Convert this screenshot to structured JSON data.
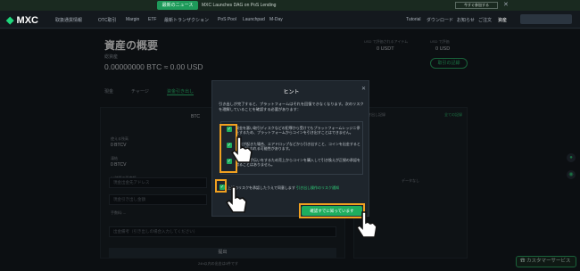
{
  "banner": {
    "pill": "最新のニュース",
    "message": "MXC Launches DAG on PoS Lending",
    "join": "今すぐ参加する",
    "close": "✕"
  },
  "nav": {
    "logo_text": "MXC",
    "items": [
      "取扱通貨情報",
      "OTC取引",
      "Margin",
      "ETF",
      "最新トランザクション",
      "PoS Pool",
      "Launchpad",
      "M-Day"
    ],
    "right_items": [
      "Tutorial",
      "ダウンロード",
      "お知らせ",
      "ご注文",
      "資産"
    ]
  },
  "page": {
    "title": "資産の概要",
    "subtitle": "総資産",
    "balance": "0.00000000 BTC ≈ 0.00 USD",
    "stats": [
      {
        "label": "USD で評価されるアイテム",
        "value": "0 USDT"
      },
      {
        "label": "USD で評価",
        "value": "0 USD"
      }
    ],
    "history_btn": "取引の記録",
    "tabs": [
      "現金",
      "チャージ",
      "資金引き出し"
    ]
  },
  "left_panel": {
    "coin": "BTC",
    "rows": [
      {
        "label": "使える残高",
        "value": "0 BTCV"
      },
      {
        "label": "凍結",
        "value": "0 BTCV"
      },
      {
        "label": "24時間の限度額",
        "value": "0 BTCV"
      }
    ],
    "address_placeholder": "現金出金先アドレス",
    "amount_placeholder": "現金引き出し金額",
    "fee_label": "手数料: --",
    "memo_placeholder": "出金備考（引き出しの場合入力してください）",
    "submit": "提出",
    "note": "24h以内の出金は0件です"
  },
  "right_panel": {
    "title": "現金引き出し記録",
    "link": "全ての記録",
    "empty": "データなし"
  },
  "support": "カスタマーサービス",
  "modal": {
    "title": "ヒント",
    "close": "✕",
    "intro": "引き出しが完了すると、プラットフォームはそれを回復できなくなります。次のリスクを理解していることを確認する必要があります：",
    "items": [
      "資金を悪い取引ディスクなどの犯罪から受けてもプラットフォームレッジニ停止するため、プラットフォームからコインを引き出すことはできません。",
      "詐欺が起きた場合、エアドロップなどから引き出すこと、コインを出金すると資産が失われる可能性があります。",
      "取引のお手伝いをするため売上からコインを購入して引き換えが正規の承認を得ることはありません。"
    ],
    "agree_text": "上記のリスクを承認したうえで同意します",
    "agree_link": "引き出し操作のリスク通知",
    "confirm": "確認すでに知っています"
  }
}
